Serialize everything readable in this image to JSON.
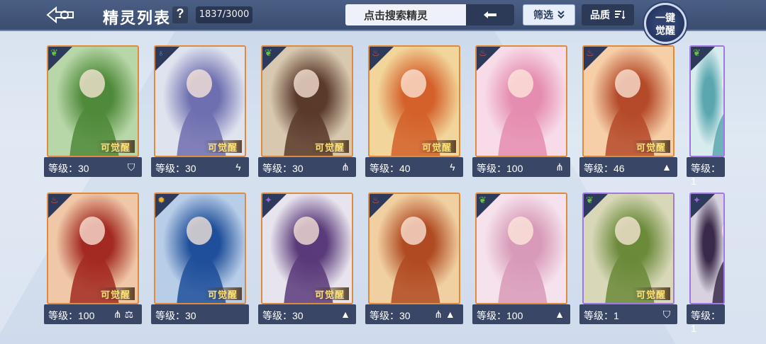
{
  "header": {
    "title": "精灵列表",
    "help": "?",
    "count": "1837/3000",
    "search_placeholder": "点击搜索精灵",
    "filter_label": "筛选",
    "quality_label": "品质",
    "awaken_line1": "一键",
    "awaken_line2": "觉醒"
  },
  "cards": [
    {
      "level": "等级：30",
      "element": "grass",
      "class": "shield",
      "awaken": "可觉醒",
      "frame": "orange",
      "art": "green-dragon"
    },
    {
      "level": "等级：30",
      "element": "water",
      "class": "lightning",
      "awaken": "可觉醒",
      "frame": "orange",
      "art": "silver-maiden"
    },
    {
      "level": "等级：30",
      "element": "grass",
      "class": "claw",
      "awaken": "可觉醒",
      "frame": "orange",
      "art": "dark-warrior"
    },
    {
      "level": "等级：40",
      "element": "fire",
      "class": "lightning",
      "awaken": "可觉醒",
      "frame": "orange",
      "art": "phoenix-dragon"
    },
    {
      "level": "等级：100",
      "element": "fire",
      "class": "claw",
      "awaken": "",
      "frame": "orange",
      "art": "pink-girl"
    },
    {
      "level": "等级：46",
      "element": "fire",
      "class": "book",
      "awaken": "可觉醒",
      "frame": "orange",
      "art": "fire-fox"
    },
    {
      "level": "等级：1",
      "element": "grass",
      "class": "",
      "awaken": "",
      "frame": "purple",
      "art": "mecha"
    },
    {
      "level": "等级：100",
      "element": "fire",
      "class": "claw-scale",
      "awaken": "可觉醒",
      "frame": "orange",
      "art": "red-demon"
    },
    {
      "level": "等级：30",
      "element": "light",
      "class": "",
      "awaken": "可觉醒",
      "frame": "orange",
      "art": "blue-dragon"
    },
    {
      "level": "等级：30",
      "element": "dark",
      "class": "book",
      "awaken": "可觉醒",
      "frame": "orange",
      "art": "white-fox-mage"
    },
    {
      "level": "等级：30",
      "element": "fire",
      "class": "claw-book",
      "awaken": "",
      "frame": "orange",
      "art": "monkey-king"
    },
    {
      "level": "等级：100",
      "element": "grass",
      "class": "book",
      "awaken": "",
      "frame": "orange",
      "art": "fairy"
    },
    {
      "level": "等级：1",
      "element": "grass",
      "class": "shield",
      "awaken": "可觉醒",
      "frame": "purple",
      "art": "golem"
    },
    {
      "level": "等级：1",
      "element": "dark",
      "class": "",
      "awaken": "",
      "frame": "purple",
      "art": "dark-knight"
    }
  ],
  "colors": {
    "grass": "#6bc04a",
    "water": "#4a8ee0",
    "fire": "#e0553a",
    "light": "#f0b030",
    "dark": "#9a6ad8"
  }
}
